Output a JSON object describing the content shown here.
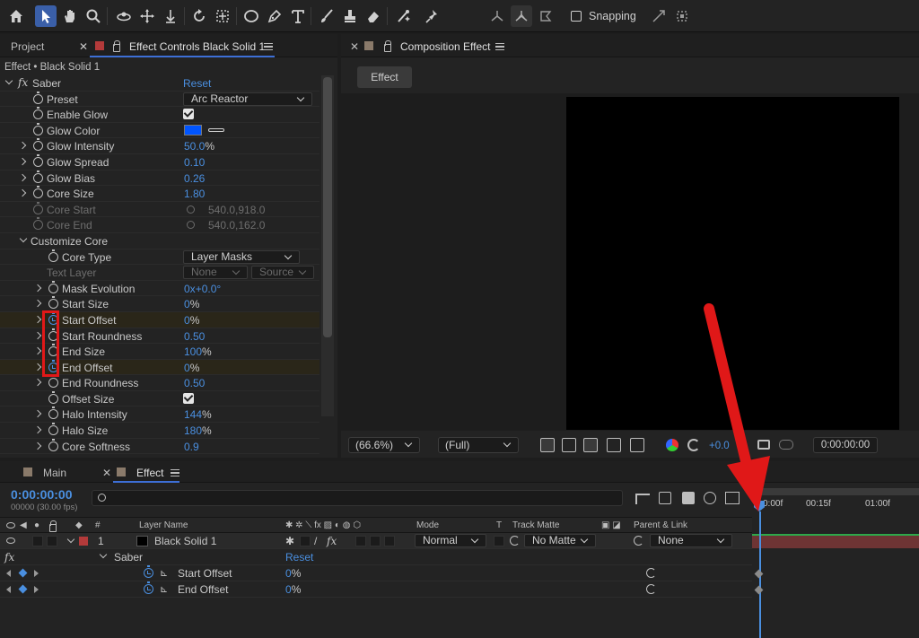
{
  "toolbar": {
    "snapping_label": "Snapping",
    "tools": [
      "home-icon",
      "selection-icon",
      "hand-icon",
      "zoom-icon",
      "orbit-icon",
      "pan-icon",
      "dolly-icon",
      "rotate-icon",
      "pan-behind-icon",
      "ellipse-icon",
      "pen-icon",
      "type-icon",
      "brush-icon",
      "clone-stamp-icon",
      "eraser-icon",
      "roto-brush-icon",
      "puppet-pin-icon"
    ]
  },
  "left_panel": {
    "tab_project": "Project",
    "tab_effect_controls": "Effect Controls Black Solid 1",
    "subtitle": "Effect • Black Solid 1",
    "effect_name": "Saber",
    "reset_label": "Reset",
    "rows": {
      "preset": {
        "label": "Preset",
        "value": "Arc Reactor"
      },
      "enable_glow": {
        "label": "Enable Glow"
      },
      "glow_color": {
        "label": "Glow Color",
        "color": "#0055ff"
      },
      "glow_intensity": {
        "label": "Glow Intensity",
        "value": "50.0",
        "unit": "%"
      },
      "glow_spread": {
        "label": "Glow Spread",
        "value": "0.10"
      },
      "glow_bias": {
        "label": "Glow Bias",
        "value": "0.26"
      },
      "core_size": {
        "label": "Core Size",
        "value": "1.80"
      },
      "core_start": {
        "label": "Core Start",
        "value": "540.0,918.0"
      },
      "core_end": {
        "label": "Core End",
        "value": "540.0,162.0"
      },
      "customize_core": {
        "label": "Customize Core"
      },
      "core_type": {
        "label": "Core Type",
        "value": "Layer Masks"
      },
      "text_layer": {
        "label": "Text Layer",
        "value": "None",
        "value2": "Source"
      },
      "mask_evolution": {
        "label": "Mask Evolution",
        "value": "0x",
        "value_b": "+0.0°"
      },
      "start_size": {
        "label": "Start Size",
        "value": "0",
        "unit": "%"
      },
      "start_offset": {
        "label": "Start Offset",
        "value": "0",
        "unit": "%"
      },
      "start_roundness": {
        "label": "Start Roundness",
        "value": "0.50"
      },
      "end_size": {
        "label": "End Size",
        "value": "100",
        "unit": "%"
      },
      "end_offset": {
        "label": "End Offset",
        "value": "0",
        "unit": "%"
      },
      "end_roundness": {
        "label": "End Roundness",
        "value": "0.50"
      },
      "offset_size": {
        "label": "Offset Size"
      },
      "halo_intensity": {
        "label": "Halo Intensity",
        "value": "144",
        "unit": "%"
      },
      "halo_size": {
        "label": "Halo Size",
        "value": "180",
        "unit": "%"
      },
      "core_softness": {
        "label": "Core Softness",
        "value": "0.9"
      }
    }
  },
  "comp_panel": {
    "tab_label": "Composition Effect",
    "view_button": "Effect",
    "zoom": "(66.6%)",
    "resolution": "(Full)",
    "exposure": "+0.0",
    "timecode": "0:00:00:00"
  },
  "timeline": {
    "tab_main": "Main",
    "tab_effect": "Effect",
    "timecode": "0:00:00:00",
    "fps": "00000 (30.00 fps)",
    "search_placeholder": "",
    "ruler": [
      "0:00f",
      "00:15f",
      "01:00f"
    ],
    "headers": {
      "num": "#",
      "layer_name": "Layer Name",
      "mode": "Mode",
      "t": "T",
      "track_matte": "Track Matte",
      "parent_link": "Parent & Link"
    },
    "layer": {
      "index": "1",
      "name": "Black Solid 1",
      "mode": "Normal",
      "matte": "No Matte",
      "parent": "None"
    },
    "effect_row": {
      "name": "Saber",
      "reset": "Reset"
    },
    "props": [
      {
        "name": "Start Offset",
        "value": "0",
        "unit": "%"
      },
      {
        "name": "End Offset",
        "value": "0",
        "unit": "%"
      }
    ],
    "colors": {
      "layer_label": "#b33a3a",
      "track_bar": "#6e3434",
      "accent": "#4a8fe0",
      "annotation": "#e01818"
    }
  }
}
